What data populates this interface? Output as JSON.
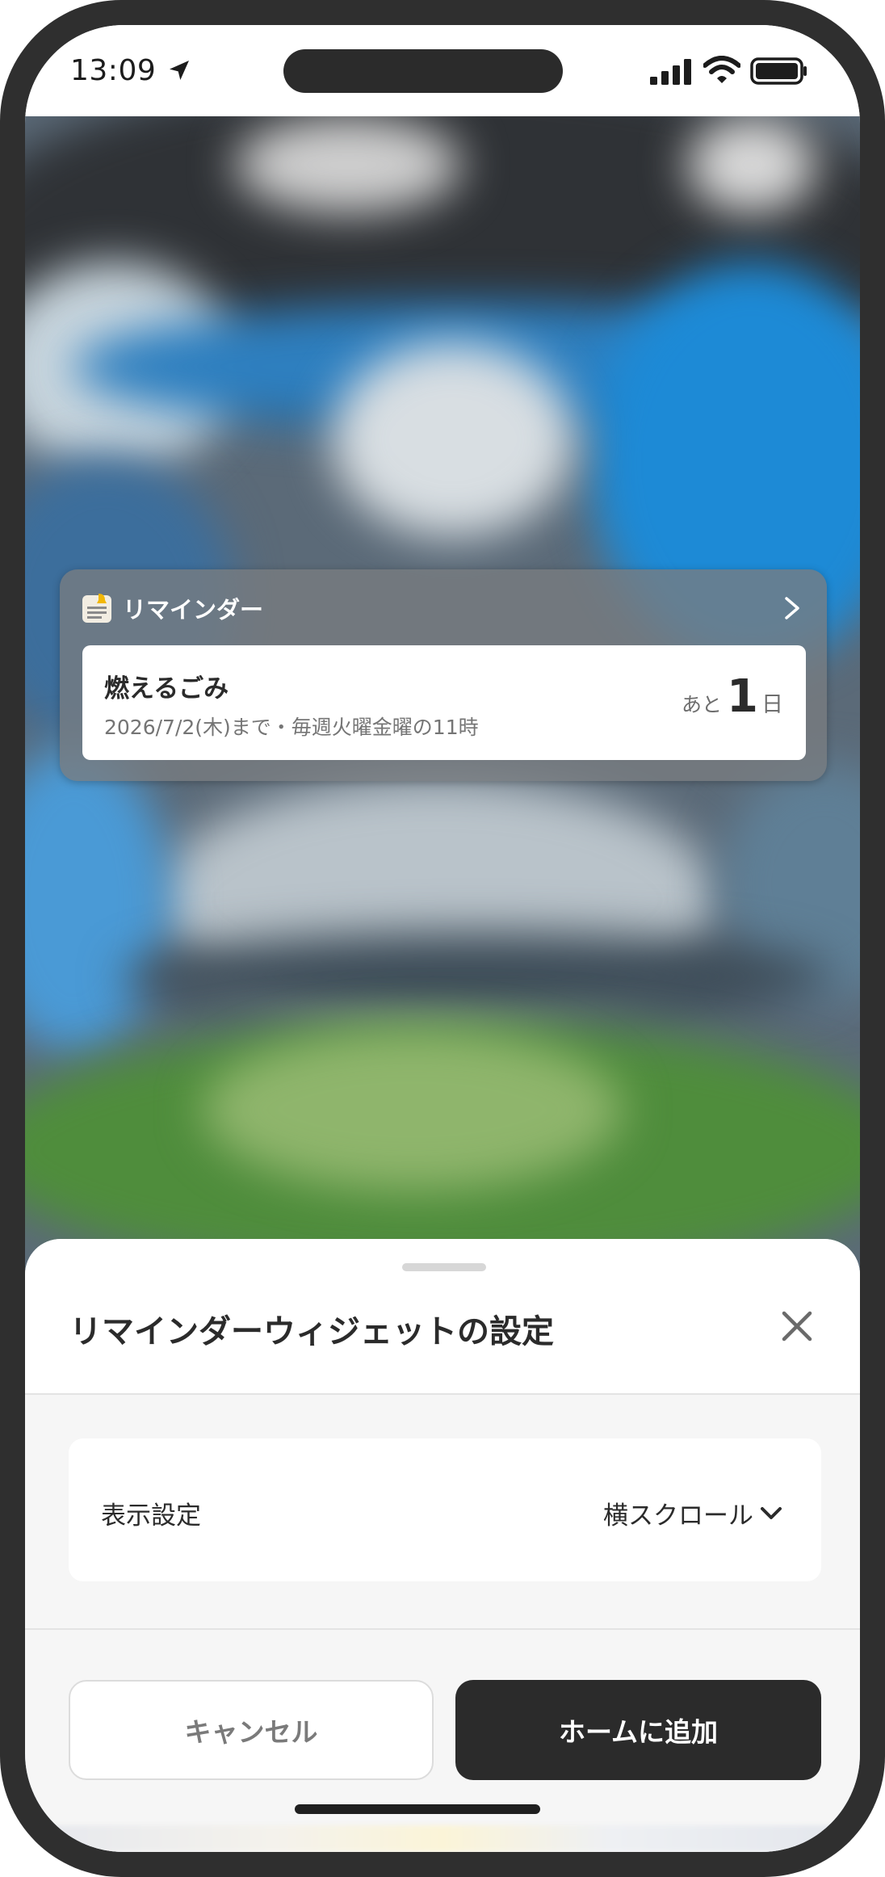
{
  "status_bar": {
    "time": "13:09",
    "icons": [
      "location-arrow-icon",
      "cellular-signal-icon",
      "wifi-icon",
      "battery-icon"
    ]
  },
  "widget": {
    "app_name": "リマインダー",
    "app_icon": "reminder-app-icon",
    "chevron": "chevron-right-icon",
    "reminder": {
      "title": "燃えるごみ",
      "subtitle": "2026/7/2(木)まで・毎週火曜金曜の11時",
      "count_prefix": "あと",
      "count_value": "1",
      "count_unit": "日"
    }
  },
  "sheet": {
    "title": "リマインダーウィジェットの設定",
    "close_icon": "close-icon",
    "setting": {
      "label": "表示設定",
      "value": "横スクロール",
      "options_icon": "chevron-down-icon"
    },
    "cancel_label": "キャンセル",
    "add_label": "ホームに追加"
  },
  "colors": {
    "frame": "#2f2f2f",
    "primary_button": "#2b2b2b",
    "sheet_background": "#f6f6f6",
    "text": "#2b2b2b"
  }
}
